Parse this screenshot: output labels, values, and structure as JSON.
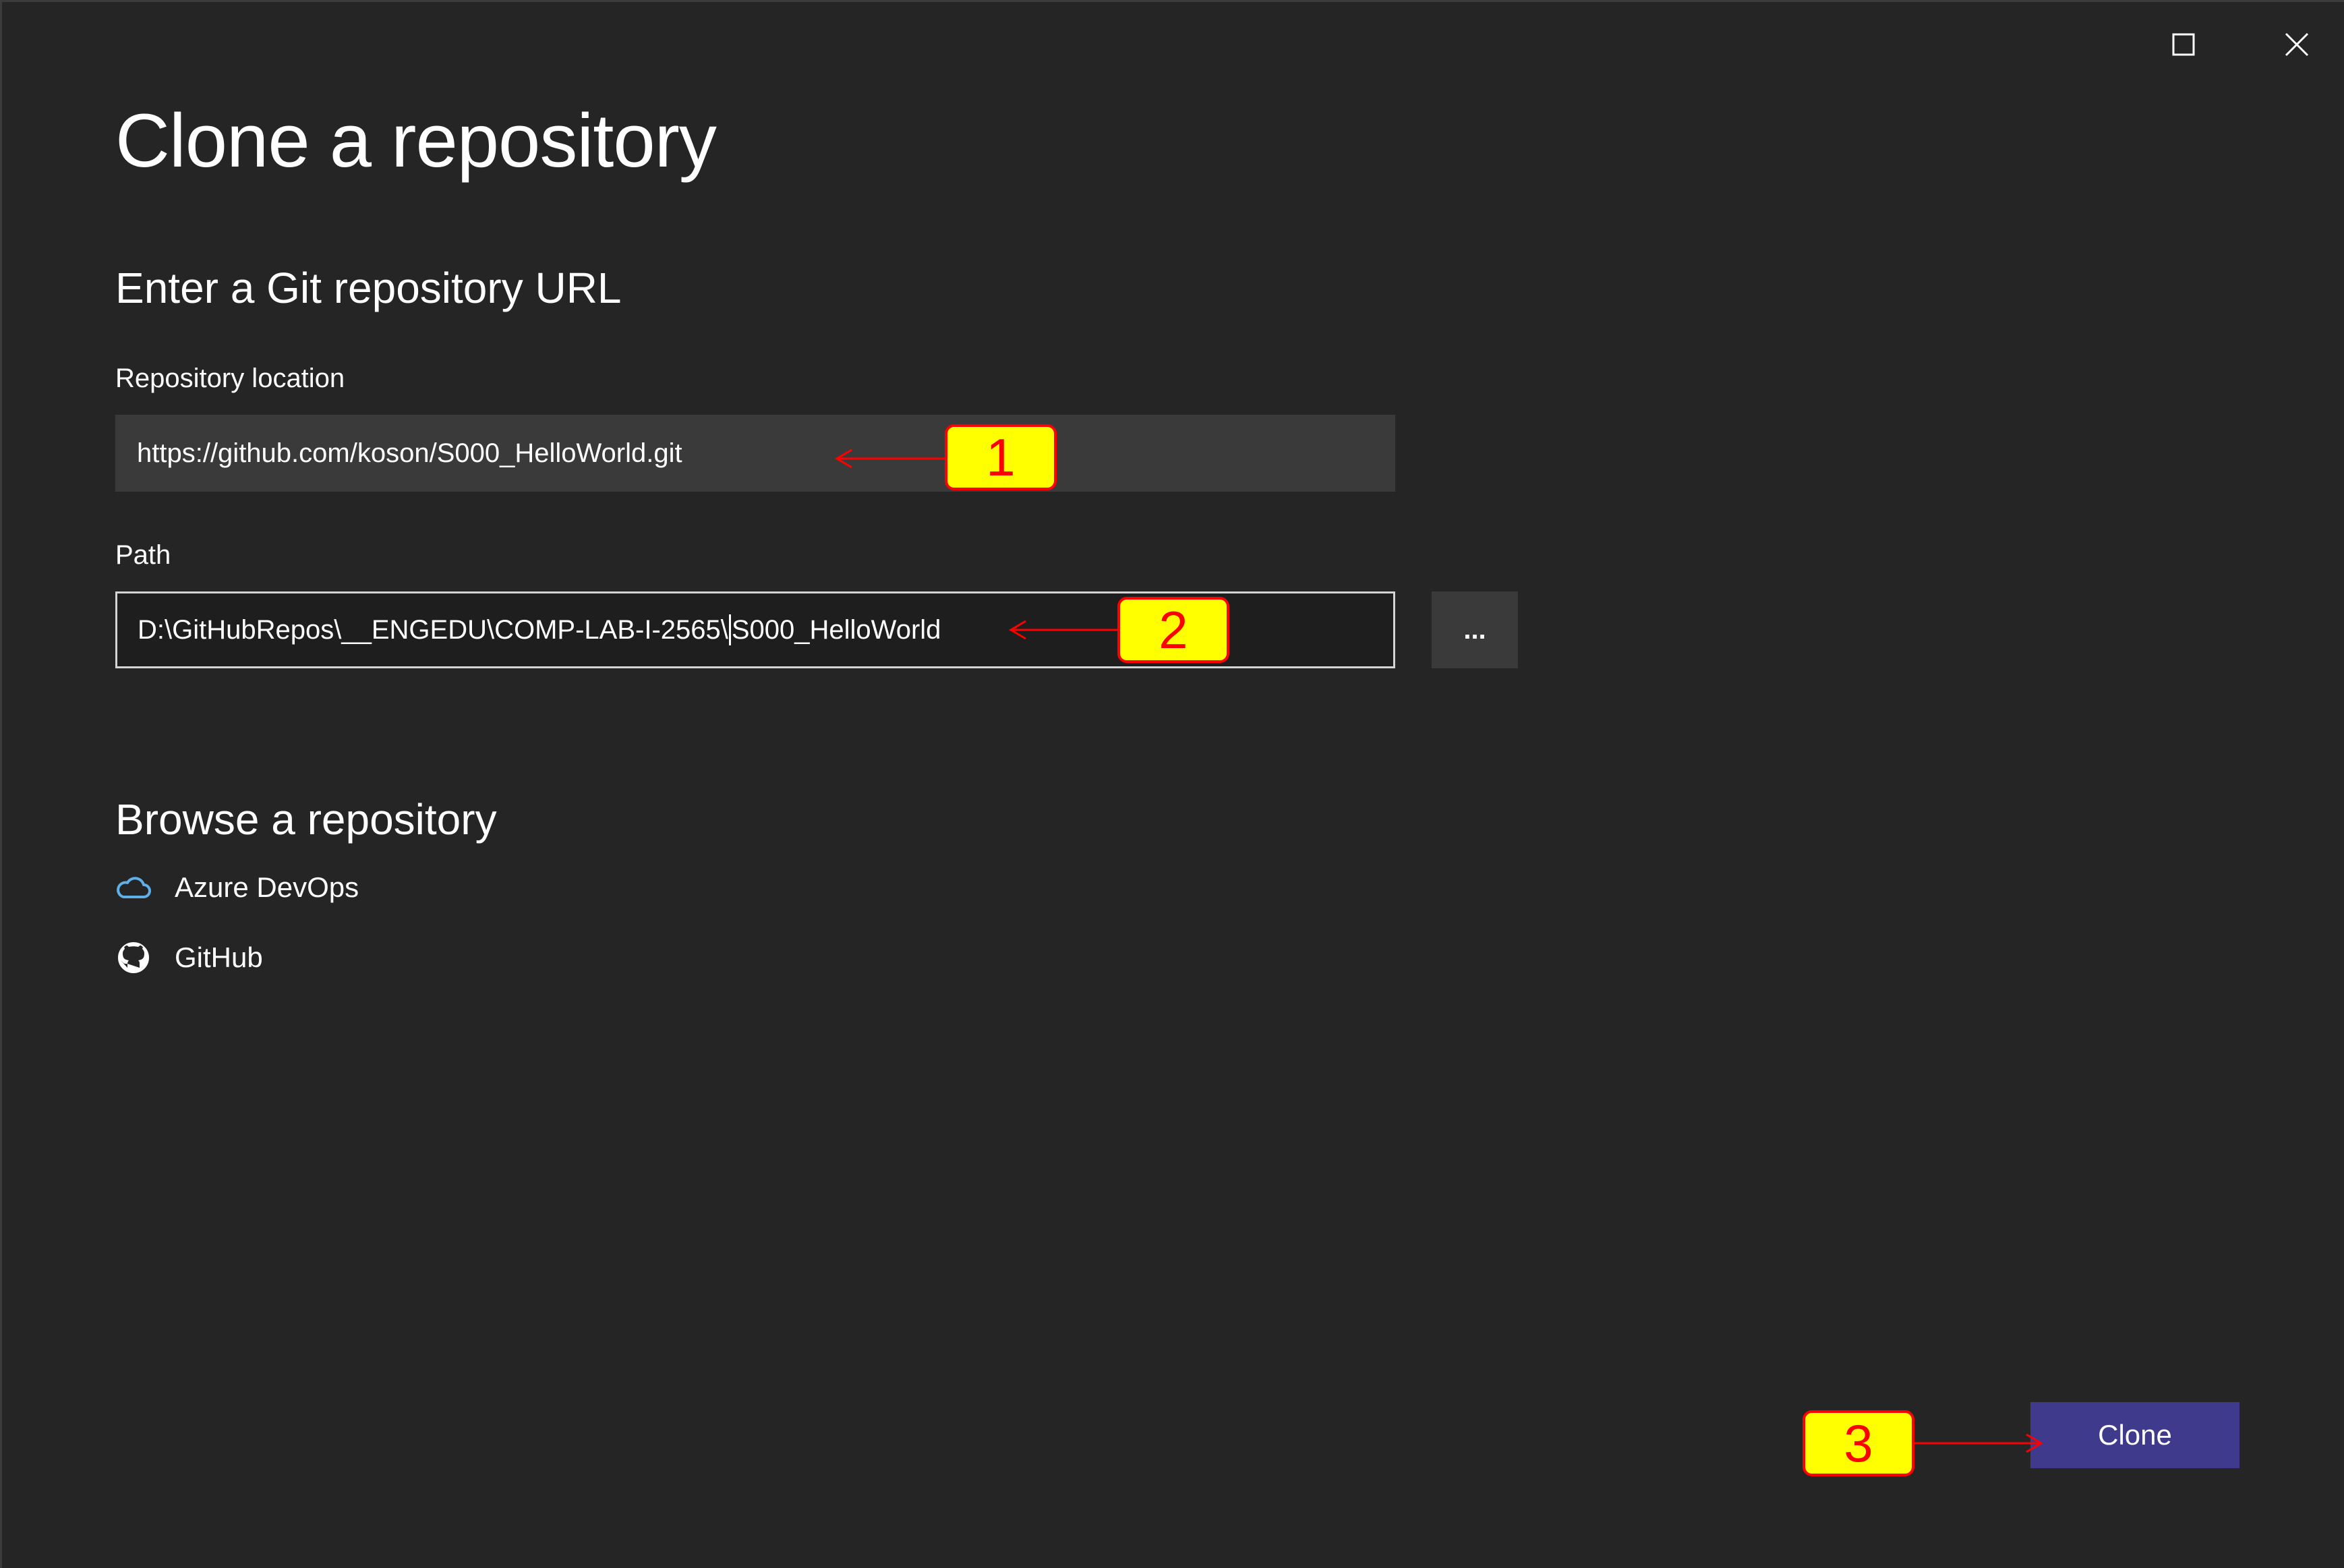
{
  "window": {
    "maximize_icon": "maximize-icon",
    "close_icon": "close-icon"
  },
  "dialog": {
    "title": "Clone a repository",
    "git_url_heading": "Enter a Git repository URL",
    "repo_location_label": "Repository location",
    "repo_location_value": "https://github.com/koson/S000_HelloWorld.git",
    "path_label": "Path",
    "path_value_before_caret": "D:\\GitHubRepos\\__ENGEDU\\COMP-LAB-I-2565\\",
    "path_value_after_caret": "S000_HelloWorld",
    "browse_path_label": "...",
    "browse_heading": "Browse a repository",
    "browse_items": [
      {
        "label": "Azure DevOps",
        "icon": "cloud-icon"
      },
      {
        "label": "GitHub",
        "icon": "github-icon"
      }
    ],
    "clone_label": "Clone"
  },
  "annotations": [
    {
      "number": "1"
    },
    {
      "number": "2"
    },
    {
      "number": "3"
    }
  ],
  "colors": {
    "background": "#252526",
    "accent": "#3f3a8c",
    "callout_fill": "#ffff00",
    "callout_stroke": "#ff0000",
    "azure_icon": "#5fb0e8"
  }
}
